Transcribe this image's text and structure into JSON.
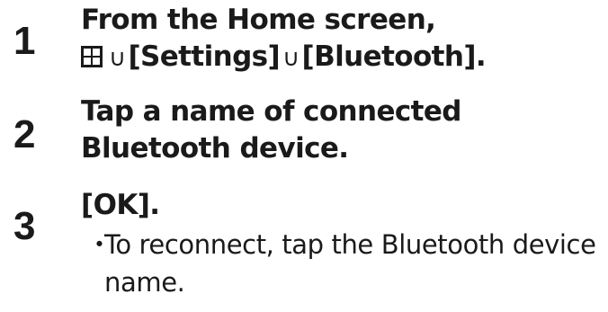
{
  "steps": [
    {
      "number": "1",
      "line1": "From the Home screen,",
      "apps_icon": "apps-grid-icon",
      "arrow1": "∪",
      "settings": "[Settings]",
      "arrow2": "∪",
      "bluetooth": "[Bluetooth]."
    },
    {
      "number": "2",
      "line1": "Tap a name of connected",
      "line2": "Bluetooth device."
    },
    {
      "number": "3",
      "line1": "[OK].",
      "bullet": "・",
      "note": "To reconnect, tap the Bluetooth device name."
    }
  ]
}
